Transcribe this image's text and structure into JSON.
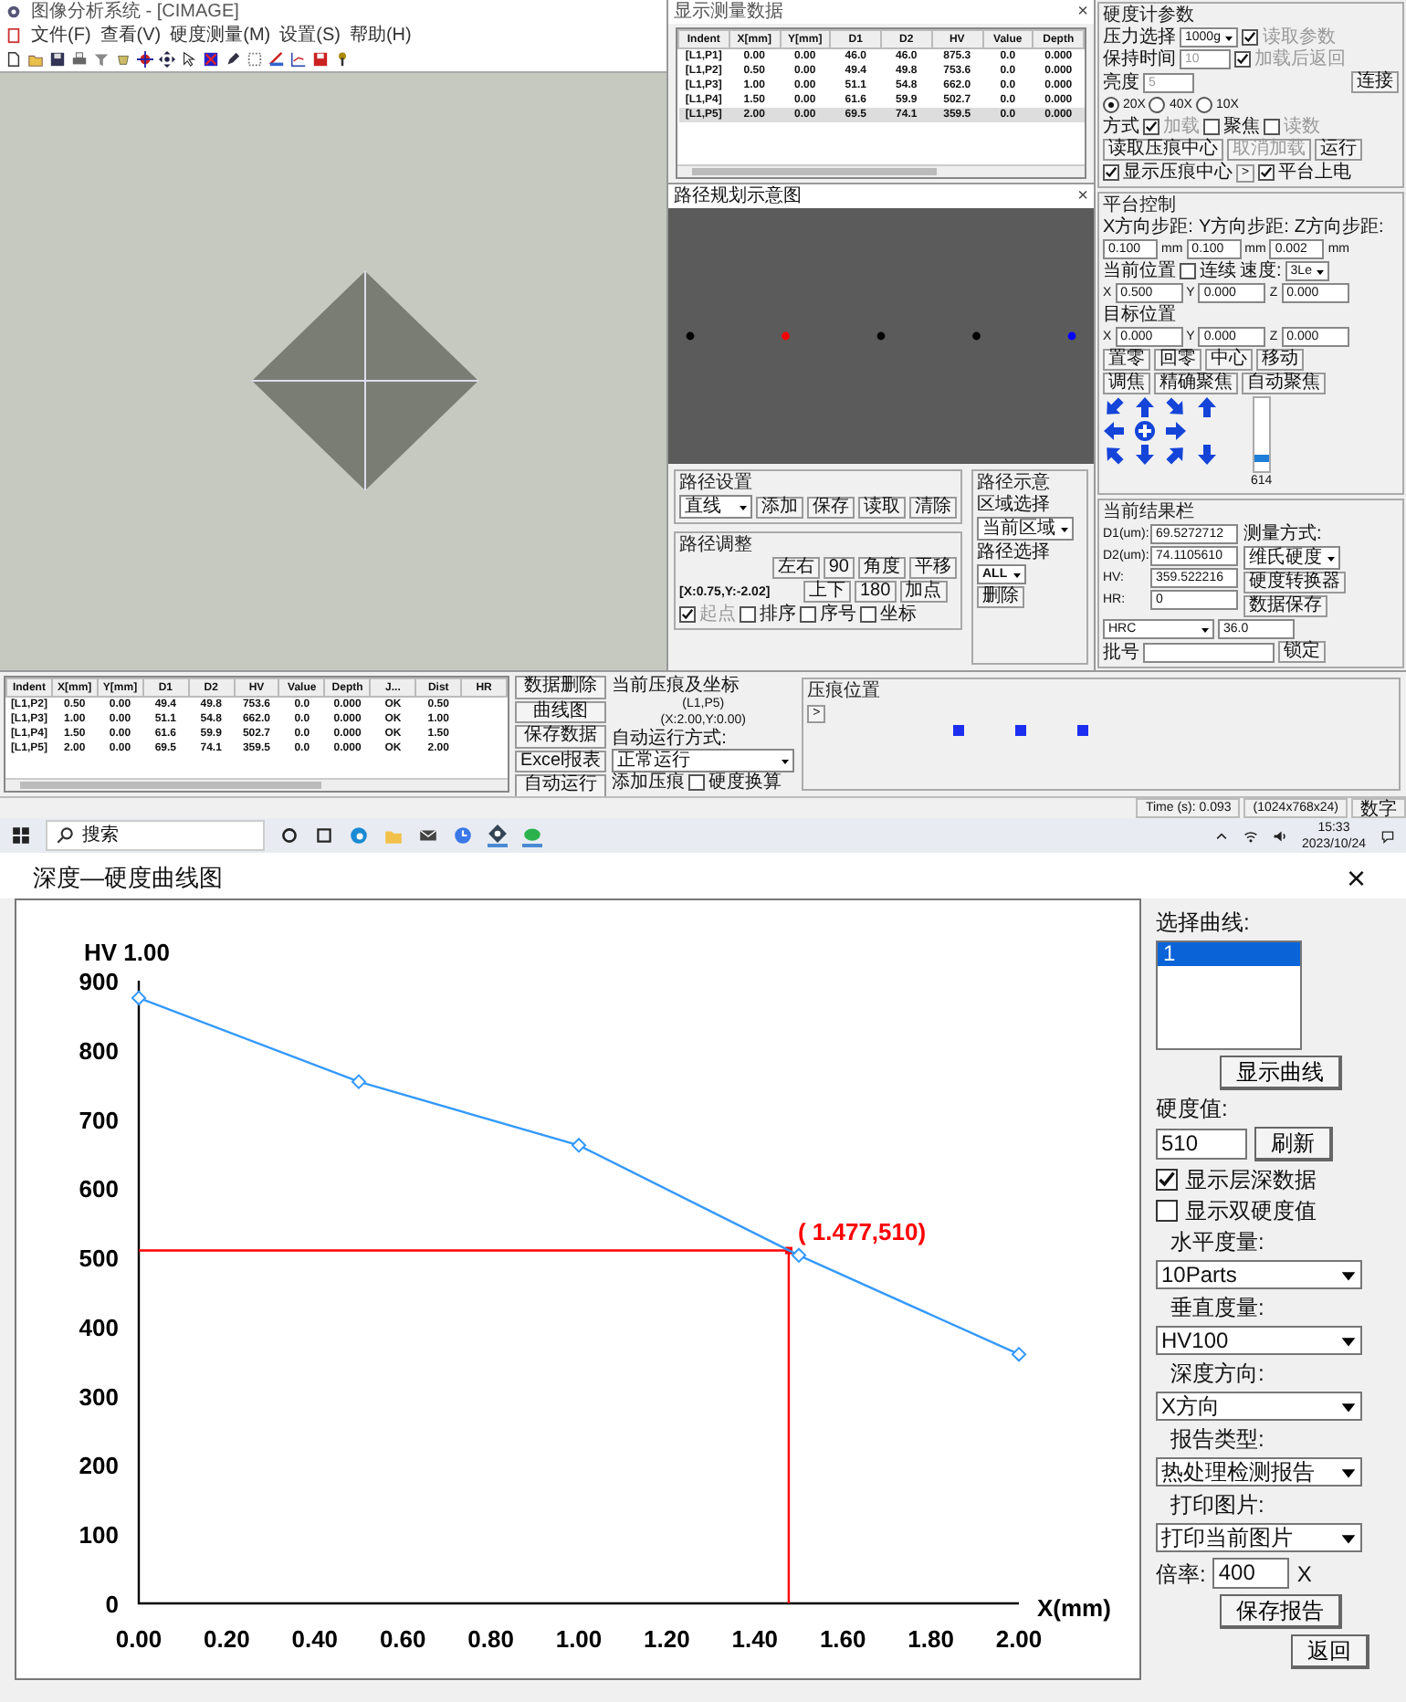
{
  "app_window": {
    "title": "图像分析系统 - [CIMAGE]",
    "menu": [
      "文件(F)",
      "查看(V)",
      "硬度测量(M)",
      "设置(S)",
      "帮助(H)"
    ]
  },
  "data_window": {
    "title": "显示测量数据",
    "close": "×",
    "columns": [
      "Indent",
      "X[mm]",
      "Y[mm]",
      "D1",
      "D2",
      "HV",
      "Value",
      "Depth"
    ],
    "rows": [
      {
        "cells": [
          "[L1,P1]",
          "0.00",
          "0.00",
          "46.0",
          "46.0",
          "875.3",
          "0.0",
          "0.000"
        ],
        "selected": false
      },
      {
        "cells": [
          "[L1,P2]",
          "0.50",
          "0.00",
          "49.4",
          "49.8",
          "753.6",
          "0.0",
          "0.000"
        ],
        "selected": false
      },
      {
        "cells": [
          "[L1,P3]",
          "1.00",
          "0.00",
          "51.1",
          "54.8",
          "662.0",
          "0.0",
          "0.000"
        ],
        "selected": false
      },
      {
        "cells": [
          "[L1,P4]",
          "1.50",
          "0.00",
          "61.6",
          "59.9",
          "502.7",
          "0.0",
          "0.000"
        ],
        "selected": false
      },
      {
        "cells": [
          "[L1,P5]",
          "2.00",
          "0.00",
          "69.5",
          "74.1",
          "359.5",
          "0.0",
          "0.000"
        ],
        "selected": true
      }
    ]
  },
  "path_window": {
    "title": "路径规划示意图",
    "close": "×",
    "points": [
      {
        "color": "#000000"
      },
      {
        "color": "#ff0000"
      },
      {
        "color": "#000000"
      },
      {
        "color": "#000000"
      },
      {
        "color": "#0000ff"
      }
    ],
    "path_settings": {
      "title": "路径设置",
      "mode": "直线",
      "buttons": [
        "添加",
        "保存",
        "读取",
        "清除"
      ]
    },
    "path_adjust": {
      "title": "路径调整",
      "coords": "[X:0.75,Y:-2.02]",
      "buttons_row1": [
        "左右",
        "90",
        "角度",
        "平移"
      ],
      "buttons_row2": [
        "上下",
        "180",
        "加点"
      ],
      "checks": [
        {
          "label": "起点",
          "checked": true,
          "disabled": true
        },
        {
          "label": "排序",
          "checked": false,
          "disabled": false
        },
        {
          "label": "序号",
          "checked": false,
          "disabled": false
        },
        {
          "label": "坐标",
          "checked": false,
          "disabled": false
        }
      ]
    },
    "path_display": {
      "title": "路径示意",
      "area_label": "区域选择",
      "area": "当前区域",
      "path_label": "路径选择",
      "path": "ALL",
      "delete": "删除"
    }
  },
  "hardness_panel": {
    "title": "硬度计参数",
    "load_label": "压力选择",
    "load": "1000g",
    "read_params": {
      "label": "读取参数",
      "checked": true,
      "disabled": true
    },
    "hold_label": "保持时间",
    "hold": "10",
    "return_after": {
      "label": "加载后返回",
      "checked": true,
      "disabled": true
    },
    "brightness_label": "亮度",
    "brightness": "5",
    "connect": "连接",
    "objectives": [
      {
        "label": "20X",
        "selected": true
      },
      {
        "label": "40X",
        "selected": false
      },
      {
        "label": "10X",
        "selected": false
      }
    ],
    "mode_label": "方式",
    "modes": [
      {
        "label": "加载",
        "checked": true,
        "disabled": true
      },
      {
        "label": "聚焦",
        "checked": false,
        "disabled": false
      },
      {
        "label": "读数",
        "checked": false,
        "disabled": true
      }
    ],
    "buttons": [
      {
        "label": "读取压痕中心",
        "disabled": false
      },
      {
        "label": "取消加载",
        "disabled": true
      },
      {
        "label": "运行",
        "disabled": false
      }
    ],
    "show_center": {
      "label": "显示压痕中心",
      "checked": true
    },
    "more": ">",
    "stage_power": {
      "label": "平台上电",
      "checked": true
    }
  },
  "stage_panel": {
    "title": "平台控制",
    "steps": [
      {
        "label": "X方向步距:",
        "value": "0.100",
        "unit": "mm"
      },
      {
        "label": "Y方向步距:",
        "value": "0.100",
        "unit": "mm"
      },
      {
        "label": "Z方向步距:",
        "value": "0.002",
        "unit": "mm"
      }
    ],
    "current_label": "当前位置",
    "continuous": {
      "label": "连续",
      "checked": false
    },
    "speed_label": "速度:",
    "speed": "3Le",
    "current": [
      {
        "axis": "X",
        "value": "0.500"
      },
      {
        "axis": "Y",
        "value": "0.000"
      },
      {
        "axis": "Z",
        "value": "0.000"
      }
    ],
    "target_label": "目标位置",
    "target": [
      {
        "axis": "X",
        "value": "0.000"
      },
      {
        "axis": "Y",
        "value": "0.000"
      },
      {
        "axis": "Z",
        "value": "0.000"
      }
    ],
    "buttons_row1": [
      "置零",
      "回零",
      "中心",
      "移动"
    ],
    "buttons_row2": [
      "调焦",
      "精确聚焦",
      "自动聚焦"
    ],
    "z_slider": {
      "level": 0.15
    },
    "z_reading": "614"
  },
  "result_panel": {
    "title": "当前结果栏",
    "fields": [
      {
        "label": "D1(um):",
        "value": "69.5272712"
      },
      {
        "label": "D2(um):",
        "value": "74.1105610"
      },
      {
        "label": "HV:",
        "value": "359.522216"
      },
      {
        "label": "HR:",
        "value": "0"
      }
    ],
    "method_label": "测量方式:",
    "method": "维氏硬度",
    "buttons": [
      "硬度转换器",
      "数据保存"
    ],
    "scale": "HRC",
    "scale_value": "36.0",
    "batch_label": "批号",
    "lock": "锁定"
  },
  "results_table": {
    "columns": [
      "Indent",
      "X[mm]",
      "Y[mm]",
      "D1",
      "D2",
      "HV",
      "Value",
      "Depth",
      "J...",
      "Dist",
      "HR"
    ],
    "rows": [
      [
        "[L1,P2]",
        "0.50",
        "0.00",
        "49.4",
        "49.8",
        "753.6",
        "0.0",
        "0.000",
        "OK",
        "0.50"
      ],
      [
        "[L1,P3]",
        "1.00",
        "0.00",
        "51.1",
        "54.8",
        "662.0",
        "0.0",
        "0.000",
        "OK",
        "1.00"
      ],
      [
        "[L1,P4]",
        "1.50",
        "0.00",
        "61.6",
        "59.9",
        "502.7",
        "0.0",
        "0.000",
        "OK",
        "1.50"
      ],
      [
        "[L1,P5]",
        "2.00",
        "0.00",
        "69.5",
        "74.1",
        "359.5",
        "0.0",
        "0.000",
        "OK",
        "2.00"
      ]
    ]
  },
  "actions": [
    "数据删除",
    "曲线图",
    "保存数据",
    "Excel报表",
    "自动运行"
  ],
  "current_indent": {
    "label": "当前压痕及坐标",
    "id": "(L1,P5)",
    "coords": "(X:2.00,Y:0.00)",
    "run_label": "自动运行方式:",
    "run_mode": "正常运行",
    "add_indent": "添加压痕",
    "convert": {
      "label": "硬度换算",
      "checked": false
    }
  },
  "indent_positions": {
    "title": "压痕位置",
    "more": ">"
  },
  "status_bar": [
    "Time (s): 0.093",
    "(1024x768x24)",
    "数字"
  ],
  "taskbar": {
    "search": "搜索",
    "time": "15:33",
    "date": "2023/10/24"
  },
  "curve_dialog": {
    "title": "深度—硬度曲线图",
    "close": "×",
    "chart_data": {
      "type": "line",
      "ylabel": "HV 1.00",
      "xlabel": "X(mm)",
      "x": [
        0,
        0.5,
        1,
        1.5,
        2
      ],
      "series": [
        {
          "color": "#3399ff",
          "marker": "diamond",
          "values": [
            875,
            754,
            662,
            503,
            360
          ]
        }
      ],
      "xlim": [
        0,
        2
      ],
      "ylim": [
        0,
        900
      ],
      "xticks": [
        {
          "value": 0,
          "label": "0.00"
        },
        {
          "value": 0.2,
          "label": "0.20"
        },
        {
          "value": 0.4,
          "label": "0.40"
        },
        {
          "value": 0.6,
          "label": "0.60"
        },
        {
          "value": 0.8,
          "label": "0.80"
        },
        {
          "value": 1,
          "label": "1.00"
        },
        {
          "value": 1.2,
          "label": "1.20"
        },
        {
          "value": 1.4,
          "label": "1.40"
        },
        {
          "value": 1.6,
          "label": "1.60"
        },
        {
          "value": 1.8,
          "label": "1.80"
        },
        {
          "value": 2,
          "label": "2.00"
        }
      ],
      "yticks": [
        0,
        100,
        200,
        300,
        400,
        500,
        600,
        700,
        800,
        900
      ],
      "ref_lines": [
        {
          "axis": "x",
          "value": 1.477,
          "color": "#ff0000"
        },
        {
          "axis": "y",
          "value": 510,
          "color": "#ff0000"
        }
      ],
      "annotations": [
        {
          "x": 1.477,
          "y": 510,
          "text": "( 1.477,510)"
        }
      ]
    },
    "select_label": "选择曲线:",
    "curves": [
      {
        "label": "1",
        "selected": true
      }
    ],
    "show_curve": "显示曲线",
    "hardness_label": "硬度值:",
    "hardness": "510",
    "refresh": "刷新",
    "show_depth": {
      "label": "显示层深数据",
      "checked": true
    },
    "show_dual": {
      "label": "显示双硬度值",
      "checked": false
    },
    "selects": [
      {
        "label": "水平度量:",
        "value": "10Parts"
      },
      {
        "label": "垂直度量:",
        "value": "HV100"
      },
      {
        "label": "深度方向:",
        "value": "X方向"
      },
      {
        "label": "报告类型:",
        "value": "热处理检测报告"
      },
      {
        "label": "打印图片:",
        "value": "打印当前图片"
      }
    ],
    "zoom_label": "倍率:",
    "zoom": "400",
    "zoom_unit": "X",
    "save_report": "保存报告",
    "back": "返回"
  }
}
